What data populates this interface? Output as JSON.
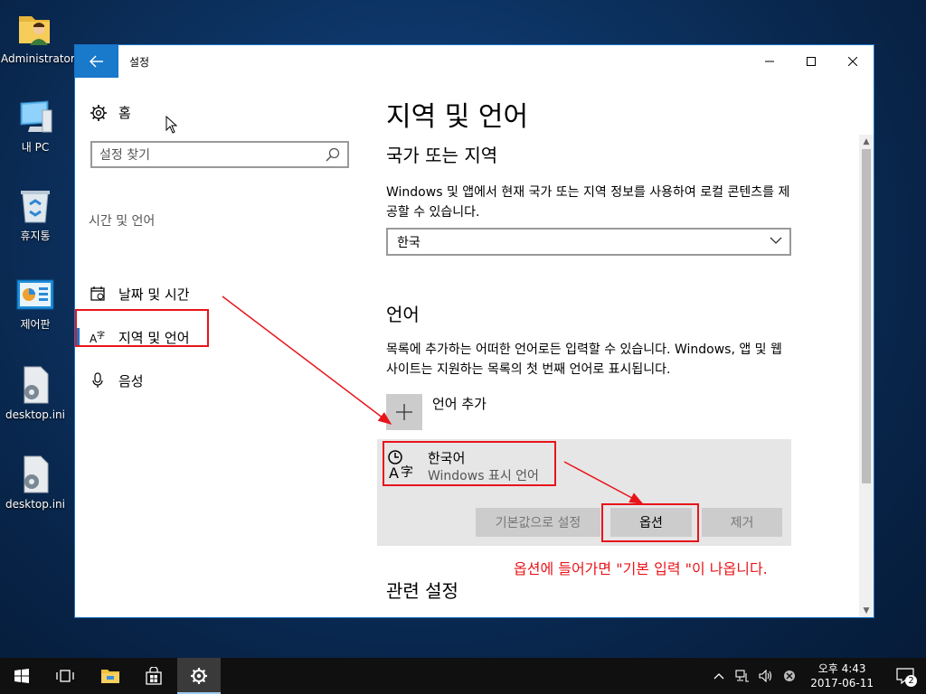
{
  "desktop": {
    "icons": [
      {
        "label": "Administrator"
      },
      {
        "label": "내 PC"
      },
      {
        "label": "휴지통"
      },
      {
        "label": "제어판"
      },
      {
        "label": "desktop.ini"
      },
      {
        "label": "desktop.ini"
      }
    ]
  },
  "window": {
    "title": "설정",
    "controls": {
      "minimize": "—",
      "maximize": "☐",
      "close": "✕"
    }
  },
  "sidebar": {
    "home_label": "홈",
    "search_placeholder": "설정 찾기",
    "section_header": "시간 및 언어",
    "items": [
      {
        "label": "날짜 및 시간",
        "icon": "calendar-icon"
      },
      {
        "label": "지역 및 언어",
        "icon": "language-icon",
        "active": true
      },
      {
        "label": "음성",
        "icon": "microphone-icon"
      }
    ]
  },
  "main": {
    "page_title": "지역 및 언어",
    "country_heading": "국가 또는 지역",
    "country_desc": "Windows 및 앱에서 현재 국가 또는 지역 정보를 사용하여 로컬 콘텐츠를 제공할 수 있습니다.",
    "country_value": "한국",
    "language_heading": "언어",
    "language_desc": "목록에 추가하는 어떠한 언어로든 입력할 수 있습니다. Windows, 앱 및 웹 사이트는 지원하는 목록의 첫 번째 언어로 표시됩니다.",
    "add_language_label": "언어 추가",
    "language_card": {
      "name": "한국어",
      "subtitle": "Windows 표시 언어",
      "buttons": {
        "set_default": "기본값으로 설정",
        "options": "옵션",
        "remove": "제거"
      }
    },
    "related_heading": "관련 설정",
    "annotation": "옵션에 들어가면 \"기본 입력 \"이  나옵니다."
  },
  "taskbar": {
    "time": "오후 4:43",
    "date": "2017-06-11",
    "notification_count": "2"
  },
  "colors": {
    "accent": "#1979ca",
    "annotation_red": "#e8141a"
  }
}
